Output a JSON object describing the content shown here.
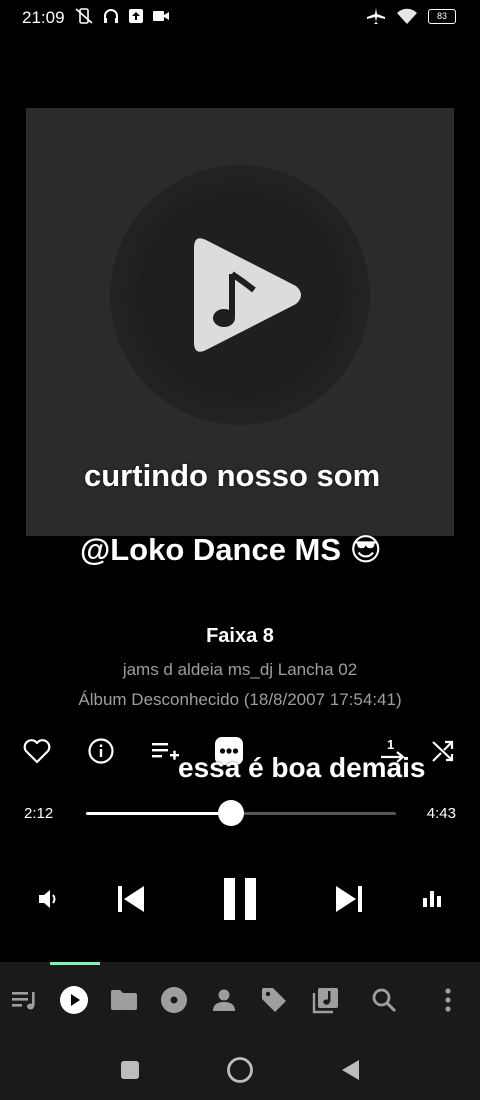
{
  "status_bar": {
    "time": "21:09",
    "battery": "83",
    "icons_left": [
      "mute-vibrate-icon",
      "headphones-icon",
      "upload-icon",
      "video-icon"
    ],
    "icons_right": [
      "airplane-icon",
      "wifi-icon",
      "battery-icon"
    ]
  },
  "overlay": {
    "line1": "curtindo nosso som",
    "line2": "@Loko Dance MS 😎",
    "line3": "essa é boa demais"
  },
  "track": {
    "title": "Faixa 8",
    "artist": "jams d aldeia ms_dj Lancha 02",
    "album": "Álbum Desconhecido (18/8/2007 17:54:41)"
  },
  "actions": [
    "favorite-icon",
    "info-icon",
    "add-to-queue-icon",
    "more-icon",
    "repeat-one-icon",
    "shuffle-icon"
  ],
  "player": {
    "elapsed": "2:12",
    "total": "4:43",
    "progress": 0.468
  },
  "controls": [
    "volume-icon",
    "previous-icon",
    "pause-icon",
    "next-icon",
    "equalizer-icon"
  ],
  "bottom_nav": {
    "active_index": 1,
    "items": [
      "queue-icon",
      "now-playing-icon",
      "folder-icon",
      "album-icon",
      "artist-icon",
      "tag-icon",
      "playlist-icon",
      "search-icon",
      "menu-dots-icon"
    ]
  },
  "system_nav": [
    "recents-button",
    "home-button",
    "back-button"
  ]
}
